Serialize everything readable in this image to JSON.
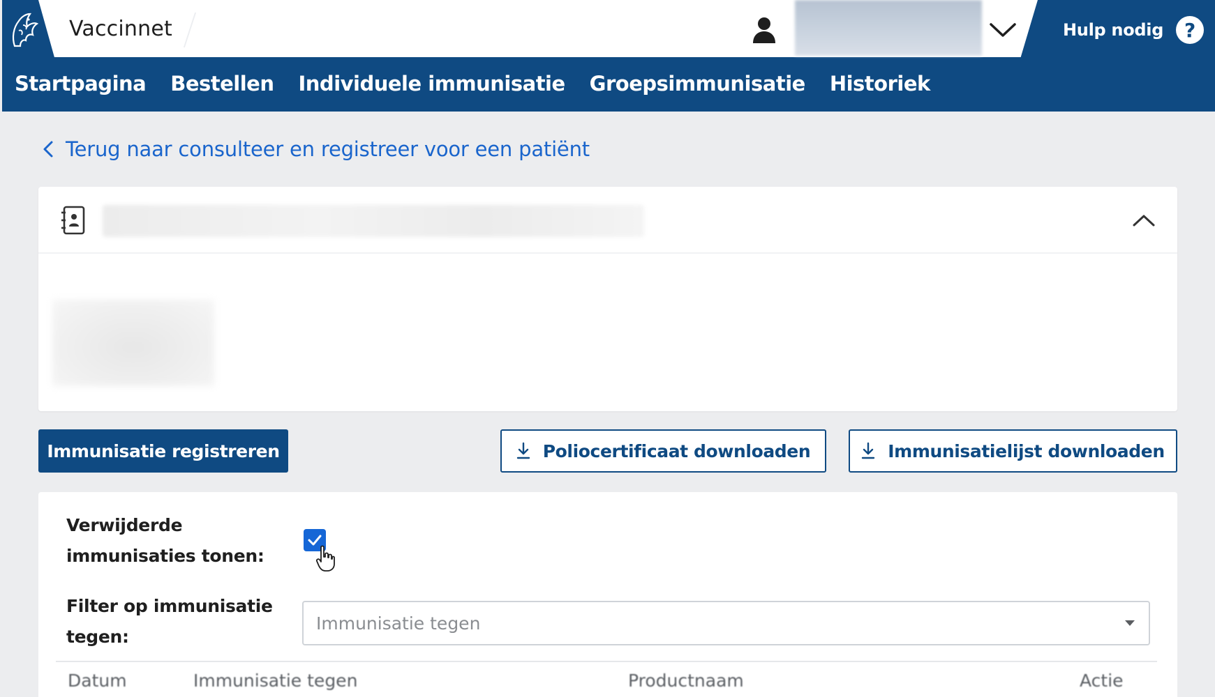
{
  "header": {
    "app_title": "Vaccinnet",
    "help_label": "Hulp nodig",
    "help_icon": "?"
  },
  "nav": {
    "items": [
      {
        "label": "Startpagina"
      },
      {
        "label": "Bestellen"
      },
      {
        "label": "Individuele immunisatie"
      },
      {
        "label": "Groepsimmunisatie"
      },
      {
        "label": "Historiek"
      }
    ]
  },
  "back_link": {
    "label": "Terug naar consulteer en registreer voor een patiënt"
  },
  "actions": {
    "register_label": "Immunisatie registreren",
    "polio_download_label": "Poliocertificaat downloaden",
    "list_download_label": "Immunisatielijst downloaden"
  },
  "filters": {
    "deleted_label": "Verwijderde immunisaties tonen:",
    "deleted_checked": true,
    "filter_label": "Filter op immunisatie tegen:",
    "filter_placeholder": "Immunisatie tegen"
  },
  "table": {
    "columns": [
      "Datum",
      "Immunisatie tegen",
      "Productnaam",
      "Actie"
    ]
  },
  "colors": {
    "brand": "#0f4a82",
    "link": "#1a65cc",
    "checkbox": "#1566d6",
    "page_bg": "#ecedef"
  },
  "icons": {
    "logo": "flemish-lion-logo-icon",
    "user": "user-icon",
    "dropdown": "chevron-down-icon",
    "help": "help-icon",
    "back": "chevron-left-icon",
    "contact": "contact-book-icon",
    "collapse": "chevron-up-icon",
    "download": "download-icon",
    "check": "check-icon",
    "cursor": "hand-cursor-icon"
  }
}
